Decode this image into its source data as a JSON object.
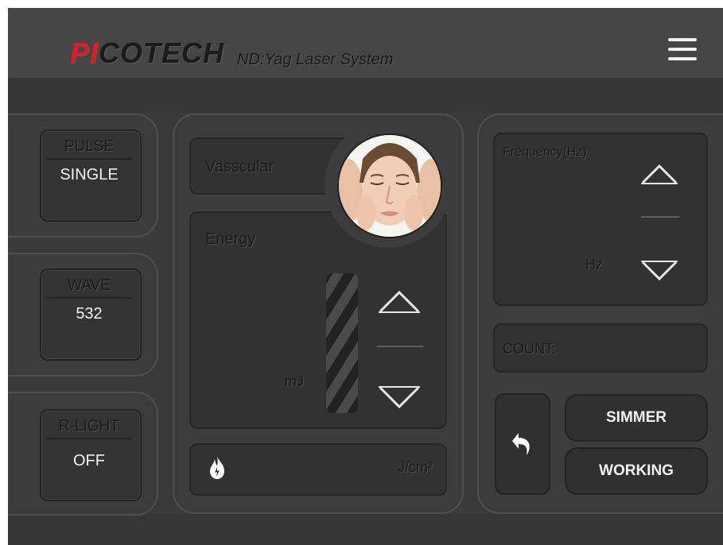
{
  "header": {
    "brand_accent": "PI",
    "brand_rest": "COTECH",
    "subtitle": "ND:Yag Laser System",
    "menu_icon": "hamburger-menu-icon"
  },
  "left_controls": [
    {
      "label": "PULSE",
      "value": "SINGLE"
    },
    {
      "label": "WAVE",
      "value": "532"
    },
    {
      "label": "R-LIGHT",
      "value": "OFF"
    }
  ],
  "center": {
    "mode_label": "Vasscular",
    "energy_label": "Energy",
    "energy_unit": "mJ",
    "fluence_unit": "J/cm²",
    "fluence_icon": "flame-icon"
  },
  "right": {
    "frequency_label": "Frequency(Hz)",
    "frequency_unit": "Hz",
    "count_label": "COUNT:",
    "back_icon": "undo-arrow-icon",
    "simmer_label": "SIMMER",
    "working_label": "WORKING"
  },
  "colors": {
    "brand_accent": "#e21a23",
    "background": "#3a3a3a",
    "header": "#464646",
    "text_light": "#f2f2f2",
    "text_embossed": "#1b1b1b"
  }
}
